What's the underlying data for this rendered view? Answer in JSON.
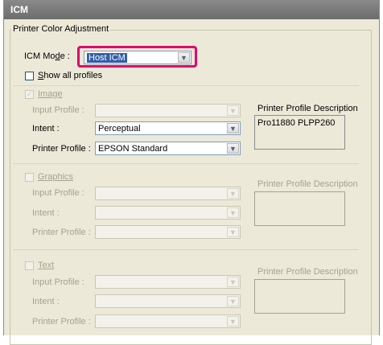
{
  "window": {
    "title": "ICM"
  },
  "group": {
    "label": "Printer Color Adjustment"
  },
  "icm_mode": {
    "label_prefix": "ICM Mo",
    "label_accel": "d",
    "label_suffix": "e :",
    "value": "Host ICM"
  },
  "show_all_profiles": {
    "accel": "S",
    "label": "how all profiles",
    "checked": false
  },
  "image": {
    "checkbox_label": "Image",
    "checked": true,
    "input_profile_label": "Input Profile :",
    "intent_label": "Intent :",
    "intent_value": "Perceptual",
    "printer_profile_label": "Printer Profile :",
    "printer_profile_value": "EPSON Standard",
    "desc_title": "Printer Profile Description",
    "desc_text": "Pro11880 PLPP260"
  },
  "graphics": {
    "checkbox_label": "Graphics",
    "input_profile_label": "Input Profile :",
    "intent_label": "Intent :",
    "printer_profile_label": "Printer Profile :",
    "desc_title": "Printer Profile Description"
  },
  "text": {
    "checkbox_label": "Text",
    "input_profile_label": "Input Profile :",
    "intent_label": "Intent :",
    "printer_profile_label": "Printer Profile :",
    "desc_title": "Printer Profile Description"
  },
  "icons": {
    "dropdown": "chevron-down-icon",
    "check": "checkmark-icon"
  }
}
